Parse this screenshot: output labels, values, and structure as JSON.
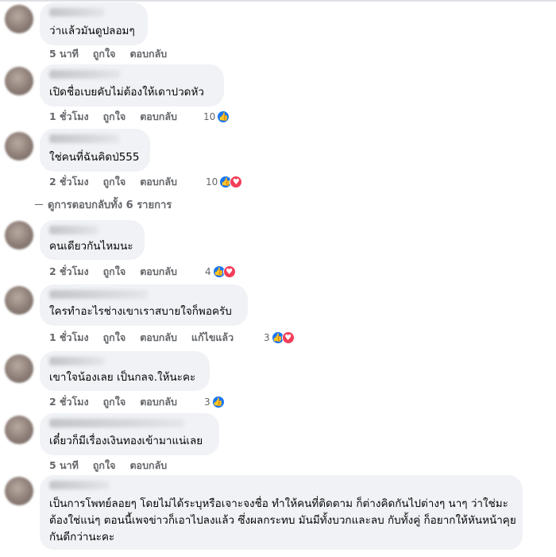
{
  "comments": [
    {
      "text": "ว่าแล้วมันดูปลอมๆ",
      "time": "5 นาที",
      "like": "ถูกใจ",
      "reply": "ตอบกลับ"
    },
    {
      "text": "เปิดชื่อเบยคับไม่ต้องให้เดาปวดหัว",
      "time": "1 ชั่วโมง",
      "like": "ถูกใจ",
      "reply": "ตอบกลับ",
      "reactions": "10"
    },
    {
      "text": "ใช่คนที่ฉันคิดป่555",
      "time": "2 ชั่วโมง",
      "like": "ถูกใจ",
      "reply": "ตอบกลับ",
      "reactions": "10"
    },
    {
      "text": "คนเดียวกันไหมนะ",
      "time": "2 ชั่วโมง",
      "like": "ถูกใจ",
      "reply": "ตอบกลับ",
      "reactions": "4"
    },
    {
      "text": "ใครทำอะไรช่างเขาเราสบายใจก็พอครับ",
      "time": "1 ชั่วโมง",
      "like": "ถูกใจ",
      "reply": "ตอบกลับ",
      "edited": "แก้ไขแล้ว",
      "reactions": "3"
    },
    {
      "text": "เขาใจน้องเลย เป็นกลจ.ให้นะคะ",
      "time": "2 ชั่วโมง",
      "like": "ถูกใจ",
      "reply": "ตอบกลับ",
      "reactions": "3"
    },
    {
      "text": "เดี๋ยวก็มีเรื่องเงินทองเข้ามาแน่เลย",
      "time": "5 นาที",
      "like": "ถูกใจ",
      "reply": "ตอบกลับ"
    },
    {
      "text": "เป็นการโพทย์ลอยๆ โดยไม่ได้ระบุหรือเจาะจงชื่อ ทำให้คนที่ติดตาม ก็ต่างคิดกันไปต่างๆ นาๆ ว่าใช่มะ ต้องใช่แน่ๆ ตอนนี้เพจข่าวก็เอาไปลงแล้ว ซึ่งผลกระทบ มันมีทั้งบวกและลบ กับทั้งคู่ ก็อยากให้หันหน้าคุยกันดีกว่านะคะ"
    }
  ],
  "view_replies": "ดูการตอบกลับทั้ง 6 รายการ",
  "icons": {
    "like": "thumbs-up-icon",
    "love": "heart-icon"
  },
  "colors": {
    "like": "#1877f2",
    "love": "#f33e58",
    "bubble": "#f0f2f5",
    "meta": "#65676b"
  }
}
